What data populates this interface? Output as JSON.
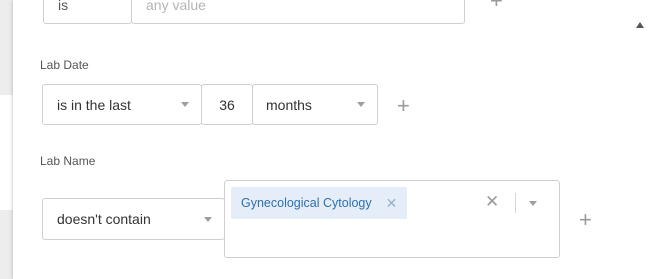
{
  "top_field": {
    "left_value": "is",
    "right_value": "any value"
  },
  "lab_date": {
    "label": "Lab Date",
    "operator": "is in the last",
    "amount": "36",
    "unit": "months"
  },
  "lab_name": {
    "label": "Lab Name",
    "operator": "doesn't contain",
    "selected_chips": [
      {
        "label": "Gynecological Cytology"
      }
    ]
  },
  "icons": {
    "add": "plus-icon",
    "remove": "close-icon",
    "clear": "close-icon",
    "dropdown": "chevron-down-icon",
    "scroll": "scroll-up-arrow-icon"
  },
  "colors": {
    "chip_background": "#e5eef8",
    "chip_text": "#2f6fb0",
    "border": "#cfcfcf"
  }
}
